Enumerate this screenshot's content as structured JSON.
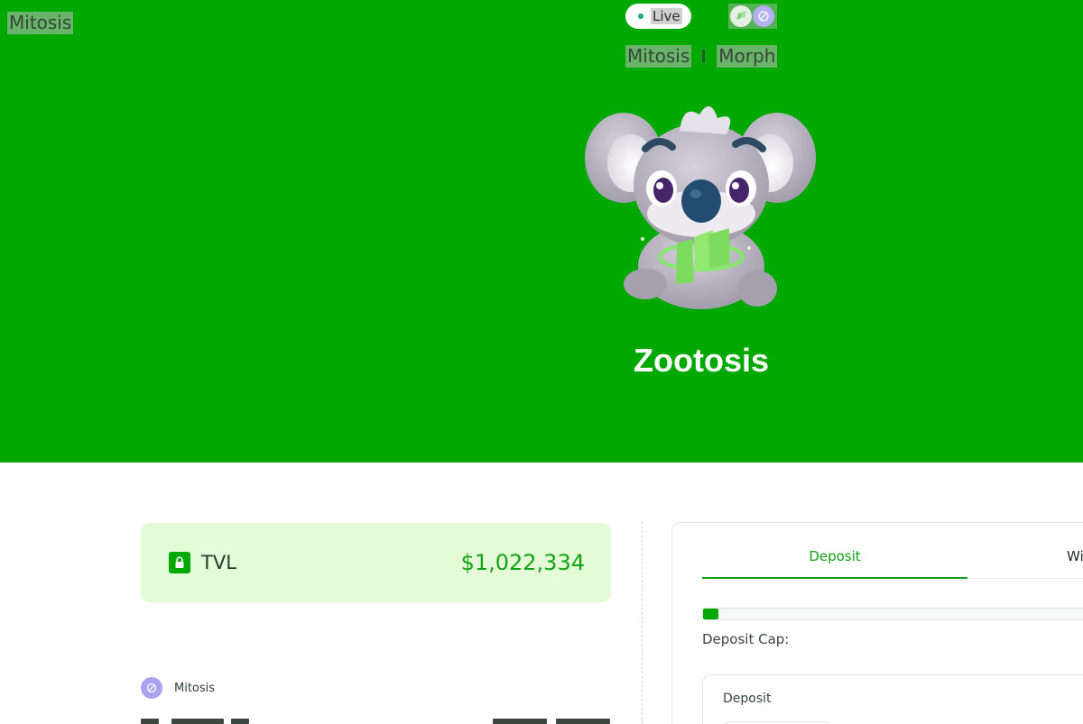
{
  "header": {
    "brand": "Mitosis",
    "status": "Live",
    "chain_icons": [
      "morph-leaf-icon",
      "mitosis-icon"
    ],
    "pair": [
      "Mitosis",
      "Morph"
    ],
    "title": "Zootosis",
    "mascot": "koala-mascot"
  },
  "tvl": {
    "label": "TVL",
    "value": "$1,022,334"
  },
  "protocol": {
    "label": "Mitosis"
  },
  "deposit_panel": {
    "tabs": [
      {
        "label": "Deposit",
        "active": true
      },
      {
        "label": "Wi",
        "active": false
      }
    ],
    "progress": 0.04,
    "cap_label": "Deposit Cap:",
    "input_label": "Deposit"
  },
  "colors": {
    "brand_green": "#00a800",
    "accent_green": "#15a215",
    "tvl_bg": "#e3fbd6",
    "mitosis_purple": "#a8a4f2"
  }
}
